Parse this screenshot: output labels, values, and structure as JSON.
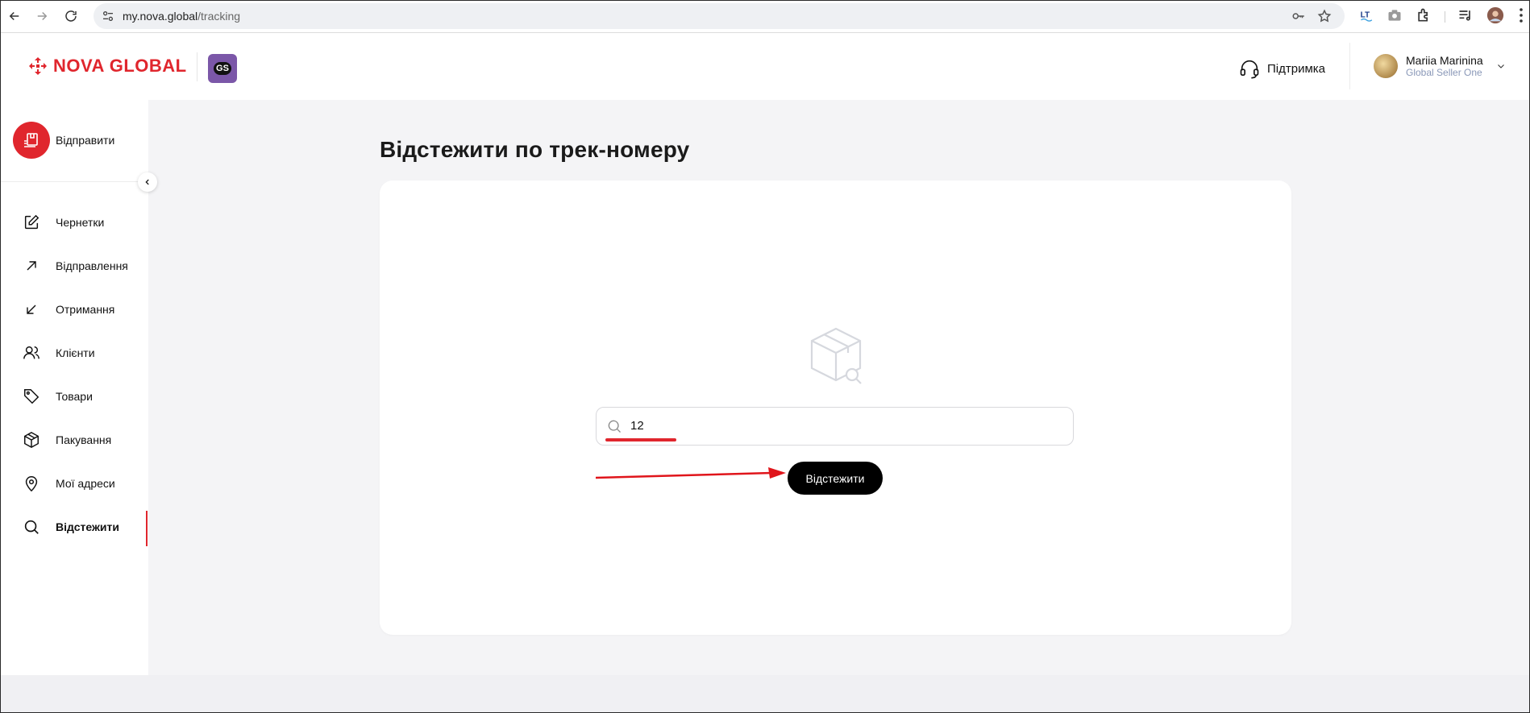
{
  "browser": {
    "url_host": "my.nova.global",
    "url_path": "/tracking"
  },
  "header": {
    "brand": "NOVA GLOBAL",
    "badge": "GS",
    "support_label": "Підтримка",
    "user_name": "Mariia Marinina",
    "user_role": "Global Seller One"
  },
  "sidebar": {
    "send_label": "Відправити",
    "items": [
      {
        "label": "Чернетки",
        "icon": "edit-icon"
      },
      {
        "label": "Відправлення",
        "icon": "arrow-up-right-icon"
      },
      {
        "label": "Отримання",
        "icon": "arrow-down-left-icon"
      },
      {
        "label": "Клієнти",
        "icon": "users-icon"
      },
      {
        "label": "Товари",
        "icon": "tag-icon"
      },
      {
        "label": "Пакування",
        "icon": "box-icon"
      },
      {
        "label": "Мої адреси",
        "icon": "map-pin-icon"
      },
      {
        "label": "Відстежити",
        "icon": "search-icon",
        "active": true
      }
    ]
  },
  "main": {
    "title": "Відстежити по трек-номеру",
    "search_value": "12",
    "track_button": "Відстежити"
  },
  "colors": {
    "brand_red": "#e0262d",
    "badge_purple": "#7b57a8",
    "background": "#f4f4f6"
  }
}
